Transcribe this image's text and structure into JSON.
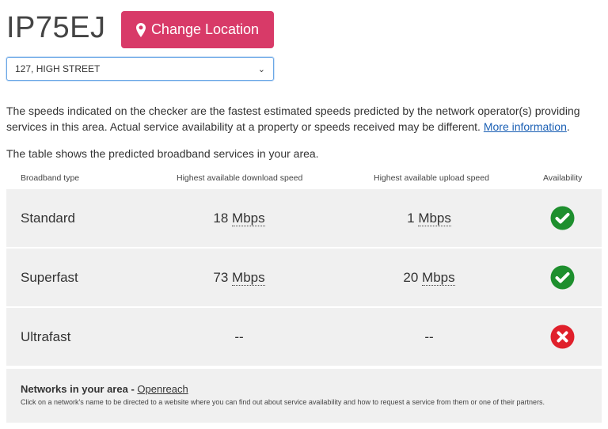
{
  "postcode": "IP75EJ",
  "change_location_label": "Change Location",
  "address_select": {
    "selected": "127, HIGH STREET"
  },
  "info": {
    "text": "The speeds indicated on the checker are the fastest estimated speeds predicted by the network operator(s) providing services in this area. Actual service availability at a property or speeds received may be different.",
    "link": "More information",
    "after_link": "."
  },
  "table_intro": "The table shows the predicted broadband services in your area.",
  "table": {
    "headers": {
      "type": "Broadband type",
      "download": "Highest available download speed",
      "upload": "Highest available upload speed",
      "availability": "Availability"
    },
    "rows": [
      {
        "type": "Standard",
        "down_value": "18",
        "down_unit": "Mbps",
        "up_value": "1",
        "up_unit": "Mbps",
        "available": true
      },
      {
        "type": "Superfast",
        "down_value": "73",
        "down_unit": "Mbps",
        "up_value": "20",
        "up_unit": "Mbps",
        "available": true
      },
      {
        "type": "Ultrafast",
        "down_value": "--",
        "down_unit": "",
        "up_value": "--",
        "up_unit": "",
        "available": false
      }
    ]
  },
  "networks": {
    "heading": "Networks in your area -",
    "link": "Openreach",
    "description": "Click on a network's name to be directed to a website where you can find out about service availability and how to request a service from them or one of their partners."
  },
  "colors": {
    "accent": "#d83a68",
    "available": "#1e8f2e",
    "unavailable": "#e0202b"
  }
}
